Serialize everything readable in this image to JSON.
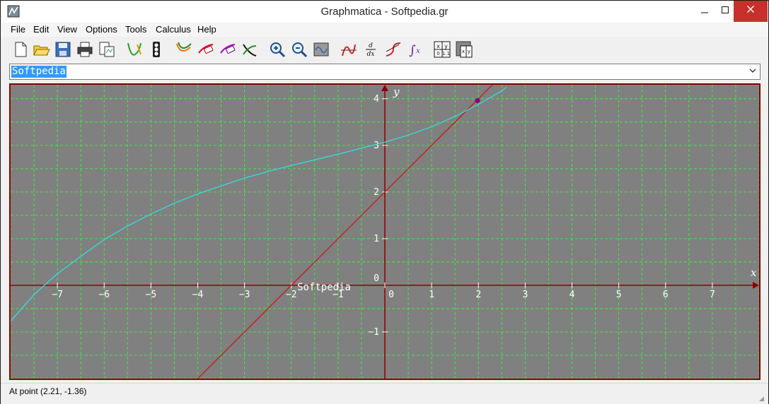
{
  "window": {
    "title": "Graphmatica - Softpedia.gr"
  },
  "menu": [
    "File",
    "Edit",
    "View",
    "Options",
    "Tools",
    "Calculus",
    "Help"
  ],
  "equation": {
    "value": "Softpedia"
  },
  "graph": {
    "watermark_center": "Softpedia",
    "x_axis_label": "x",
    "y_axis_label": "y",
    "x_ticks": [
      -7,
      -6,
      -5,
      -4,
      -3,
      -2,
      -1,
      0,
      1,
      2,
      3,
      4,
      5,
      6,
      7
    ],
    "y_ticks": [
      4,
      3,
      2,
      1,
      0,
      -1
    ],
    "xlim": [
      -8.0,
      8.0
    ],
    "ylim": [
      -2.0,
      4.3
    ],
    "background": "#808080",
    "grid_color": "#33ff33",
    "axis_color": "#8b0000",
    "line_color": "#cc1111",
    "curve_color": "#33dddd",
    "point_color": "#800080",
    "intersection_point": {
      "x": 1.98,
      "y": 3.96
    },
    "line_points": [
      [
        -4.0,
        -2.0
      ],
      [
        2.6,
        4.6
      ]
    ],
    "curve_points": [
      [
        -8.0,
        -0.77
      ],
      [
        -7.5,
        -0.2
      ],
      [
        -7.0,
        0.25
      ],
      [
        -6.5,
        0.62
      ],
      [
        -6.0,
        0.98
      ],
      [
        -5.5,
        1.27
      ],
      [
        -5.0,
        1.53
      ],
      [
        -4.5,
        1.76
      ],
      [
        -4.0,
        1.96
      ],
      [
        -3.5,
        2.13
      ],
      [
        -3.0,
        2.3
      ],
      [
        -2.5,
        2.44
      ],
      [
        -2.0,
        2.57
      ],
      [
        -1.5,
        2.69
      ],
      [
        -1.0,
        2.81
      ],
      [
        -0.5,
        2.94
      ],
      [
        0.0,
        3.07
      ],
      [
        0.5,
        3.22
      ],
      [
        1.0,
        3.4
      ],
      [
        1.5,
        3.62
      ],
      [
        2.0,
        3.88
      ],
      [
        2.5,
        4.17
      ],
      [
        2.6,
        4.25
      ]
    ]
  },
  "status": {
    "text": "At point (2.21, -1.36)"
  }
}
